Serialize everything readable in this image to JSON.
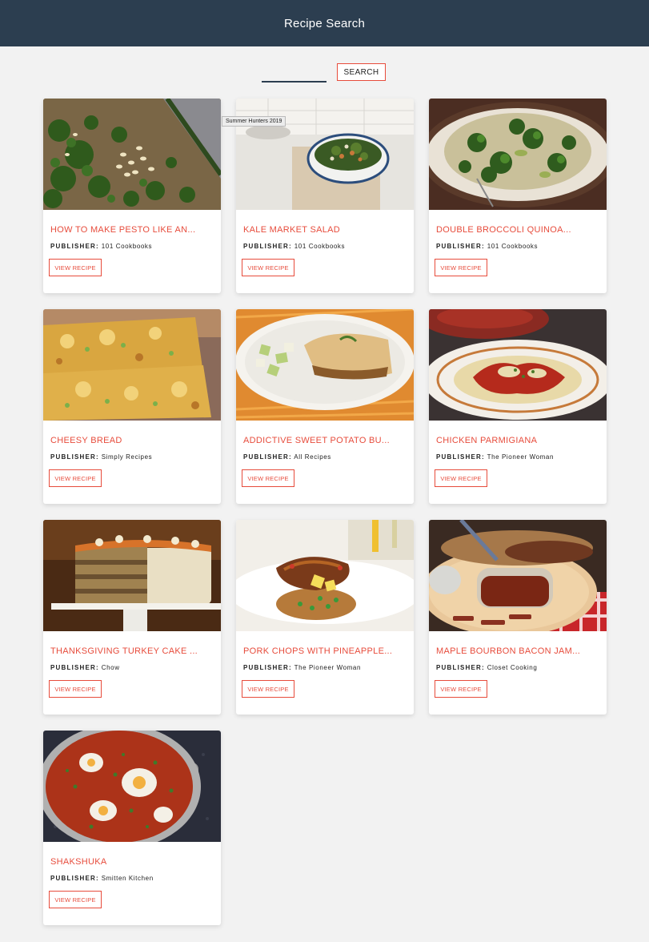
{
  "header": {
    "title": "Recipe Search"
  },
  "search": {
    "placeholder": "",
    "value": "",
    "button_label": "SEARCH"
  },
  "tooltip": "Summer Hunters 2019",
  "publisher_label": "PUBLISHER:",
  "view_label": "VIEW RECIPE",
  "recipes": [
    {
      "title": "HOW TO MAKE PESTO LIKE AN...",
      "publisher": "101 Cookbooks",
      "image": "pesto-image"
    },
    {
      "title": "KALE MARKET SALAD",
      "publisher": "101 Cookbooks",
      "image": "kale-salad-image"
    },
    {
      "title": "DOUBLE BROCCOLI QUINOA...",
      "publisher": "101 Cookbooks",
      "image": "broccoli-quinoa-image"
    },
    {
      "title": "CHEESY BREAD",
      "publisher": "Simply Recipes",
      "image": "cheesy-bread-image"
    },
    {
      "title": "ADDICTIVE SWEET POTATO BU...",
      "publisher": "All Recipes",
      "image": "sweet-potato-burrito-image"
    },
    {
      "title": "CHICKEN PARMIGIANA",
      "publisher": "The Pioneer Woman",
      "image": "chicken-parmigiana-image"
    },
    {
      "title": "THANKSGIVING TURKEY CAKE ...",
      "publisher": "Chow",
      "image": "turkey-cake-image"
    },
    {
      "title": "PORK CHOPS WITH PINEAPPLE...",
      "publisher": "The Pioneer Woman",
      "image": "pork-chops-image"
    },
    {
      "title": "MAPLE BOURBON BACON JAM...",
      "publisher": "Closet Cooking",
      "image": "bacon-jam-image"
    },
    {
      "title": "SHAKSHUKA",
      "publisher": "Smitten Kitchen",
      "image": "shakshuka-image"
    }
  ],
  "colors": {
    "header_bg": "#2c3e50",
    "accent": "#e74c3c",
    "page_bg": "#f2f2f2"
  }
}
